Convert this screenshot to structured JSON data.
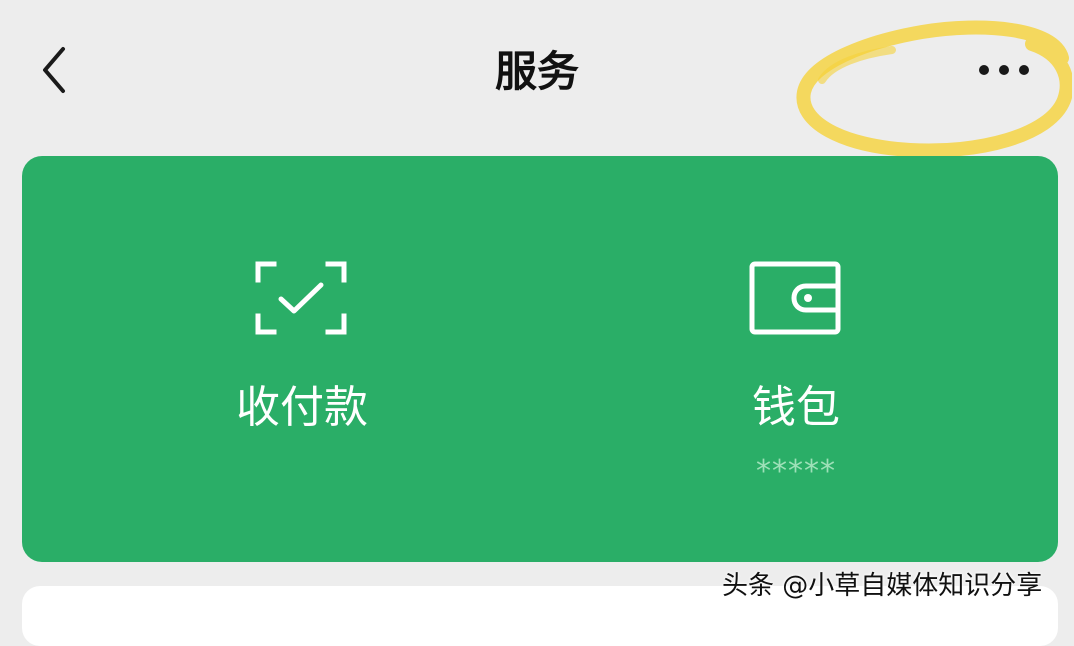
{
  "header": {
    "title": "服务",
    "back_icon": "chevron-left-icon",
    "more_icon": "more-dots-icon"
  },
  "service_card": {
    "background": "#2aae67",
    "tiles": [
      {
        "label": "收付款",
        "icon": "scan-check-icon"
      },
      {
        "label": "钱包",
        "icon": "wallet-icon",
        "sub": "*****"
      }
    ]
  },
  "annotation": {
    "highlight_color": "#f5d23a"
  },
  "watermark": {
    "text": "头条 @小草自媒体知识分享"
  }
}
